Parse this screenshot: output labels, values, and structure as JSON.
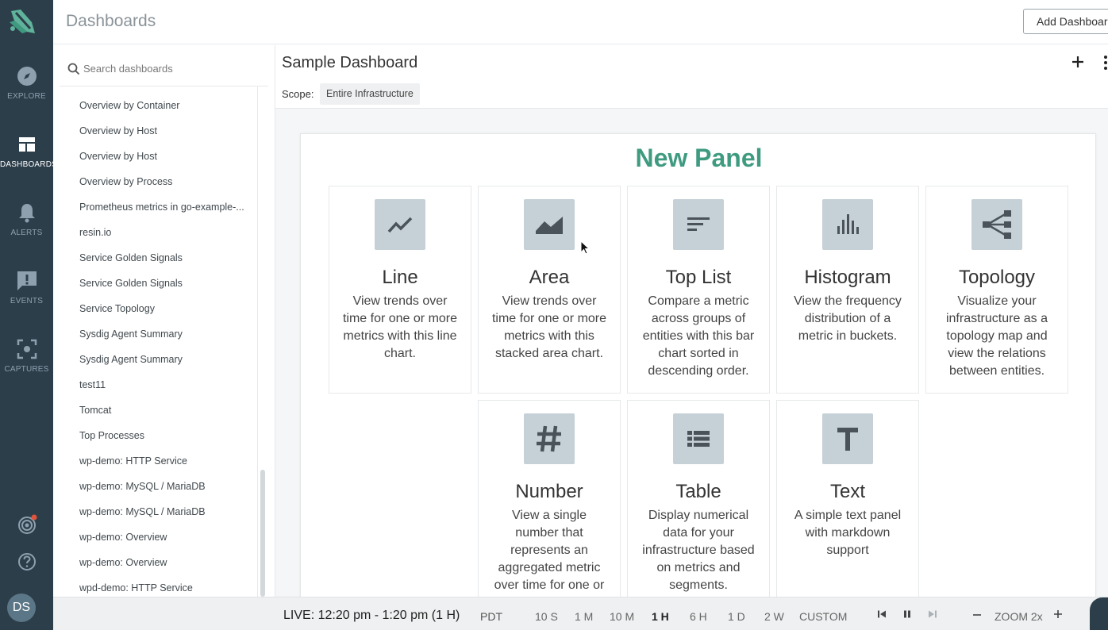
{
  "app": {
    "title": "Dashboards",
    "add_button": "Add Dashboard"
  },
  "rail": {
    "items": [
      {
        "label": "EXPLORE",
        "icon": "compass-icon"
      },
      {
        "label": "DASHBOARDS",
        "icon": "dashboard-icon"
      },
      {
        "label": "ALERTS",
        "icon": "bell-icon"
      },
      {
        "label": "EVENTS",
        "icon": "event-icon"
      },
      {
        "label": "CAPTURES",
        "icon": "capture-icon"
      }
    ],
    "avatar": "DS"
  },
  "search": {
    "placeholder": "Search dashboards"
  },
  "dashboards": [
    "Overview by Container",
    "Overview by Host",
    "Overview by Host",
    "Overview by Process",
    "Prometheus metrics in go-example-...",
    "resin.io",
    "Service Golden Signals",
    "Service Golden Signals",
    "Service Topology",
    "Sysdig Agent Summary",
    "Sysdig Agent Summary",
    "test11",
    "Tomcat",
    "Top Processes",
    "wp-demo: HTTP Service",
    "wp-demo: MySQL / MariaDB",
    "wp-demo: MySQL / MariaDB",
    "wp-demo: Overview",
    "wp-demo: Overview",
    "wpd-demo: HTTP Service"
  ],
  "dashboard": {
    "title": "Sample Dashboard",
    "scope_label": "Scope:",
    "scope_value": "Entire Infrastructure"
  },
  "panel": {
    "title": "New Panel",
    "tiles": [
      {
        "name": "Line",
        "icon": "line-chart-icon",
        "desc": "View trends over time for one or more metrics with this line chart."
      },
      {
        "name": "Area",
        "icon": "area-chart-icon",
        "desc": "View trends over time for one or more metrics with this stacked area chart."
      },
      {
        "name": "Top List",
        "icon": "top-list-icon",
        "desc": "Compare a metric across groups of entities with this bar chart sorted in descending order."
      },
      {
        "name": "Histogram",
        "icon": "histogram-icon",
        "desc": "View the frequency distribution of a metric in buckets."
      },
      {
        "name": "Topology",
        "icon": "topology-icon",
        "desc": "Visualize your infrastructure as a topology map and view the relations between entities."
      },
      {
        "name": "Number",
        "icon": "number-icon",
        "desc": "View a single number that represents an aggregated metric over time for one or"
      },
      {
        "name": "Table",
        "icon": "table-icon",
        "desc": "Display numerical data for your infrastructure based on metrics and segments."
      },
      {
        "name": "Text",
        "icon": "text-icon",
        "desc": "A simple text panel with markdown support"
      }
    ]
  },
  "timebar": {
    "live": "LIVE: 12:20 pm - 1:20 pm (1 H)",
    "timezone": "PDT",
    "ranges": [
      "10 S",
      "1 M",
      "10 M",
      "1 H",
      "6 H",
      "1 D",
      "2 W",
      "CUSTOM"
    ],
    "active_range": "1 H",
    "zoom": "ZOOM 2x"
  },
  "colors": {
    "rail": "#2d3e4b",
    "accent": "#3f9b80",
    "tile_icon_bg": "#c5d1d6"
  }
}
